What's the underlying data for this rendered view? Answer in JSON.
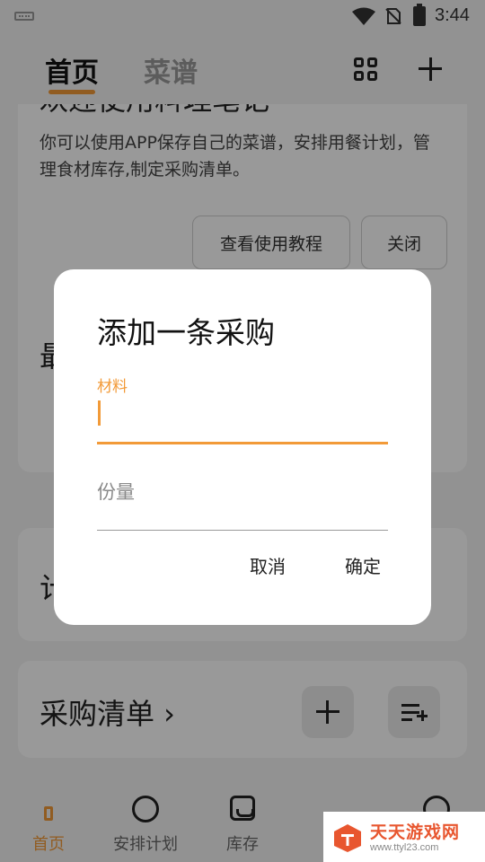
{
  "status_bar": {
    "time": "3:44"
  },
  "header": {
    "tab_home": "首页",
    "tab_recipes": "菜谱"
  },
  "welcome_card": {
    "title": "欢迎使用料理笔记",
    "description": "你可以使用APP保存自己的菜谱，安排用餐计划，管理食材库存,制定采购清单。",
    "tutorial_button": "查看使用教程",
    "close_button": "关闭"
  },
  "recent_card": {
    "title": "最"
  },
  "plan_card": {
    "title": "计"
  },
  "shopping_card": {
    "title": "采购清单 ›"
  },
  "bottom_nav": [
    {
      "label": "首页",
      "icon": "home-icon",
      "active": true
    },
    {
      "label": "安排计划",
      "icon": "plan-icon"
    },
    {
      "label": "库存",
      "icon": "stock-icon"
    },
    {
      "label": "",
      "icon": "more-icon"
    }
  ],
  "dialog": {
    "title": "添加一条采购",
    "material_label": "材料",
    "material_value": "",
    "quantity_placeholder": "份量",
    "cancel_label": "取消",
    "ok_label": "确定"
  },
  "watermark": {
    "title": "天天游戏网",
    "url": "www.ttyl23.com"
  },
  "colors": {
    "accent": "#f29a38",
    "scrim": "rgba(0,0,0,0.40)",
    "watermark_red": "#e8562f"
  }
}
